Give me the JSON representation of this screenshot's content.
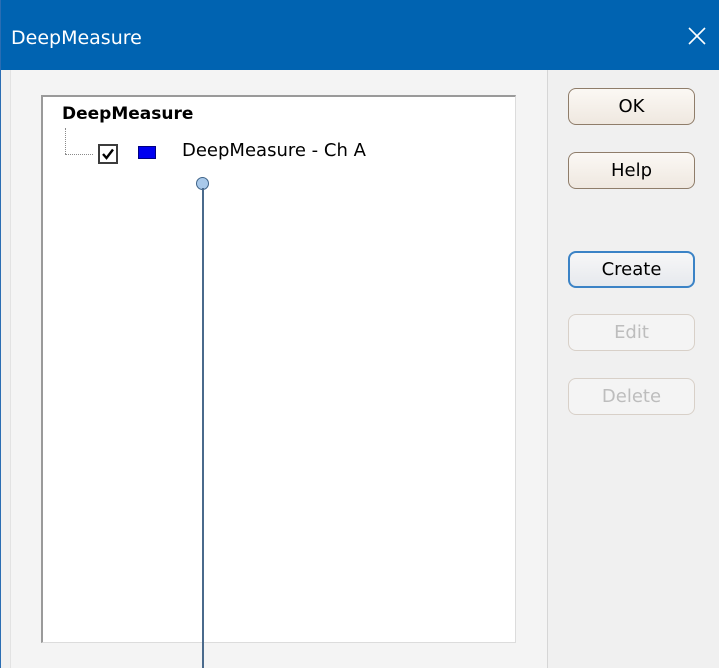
{
  "window": {
    "title": "DeepMeasure",
    "close_glyph": "×"
  },
  "tree": {
    "root_label": "DeepMeasure",
    "items": [
      {
        "label": "DeepMeasure - Ch A",
        "checked": true,
        "swatch_color": "#0000f0"
      }
    ]
  },
  "buttons": {
    "ok": "OK",
    "help": "Help",
    "create": "Create",
    "edit": "Edit",
    "delete": "Delete"
  },
  "colors": {
    "titlebar": "#0063b1",
    "cursor_line": "#4a6a8c",
    "cursor_handle": "#a9c9ea"
  }
}
